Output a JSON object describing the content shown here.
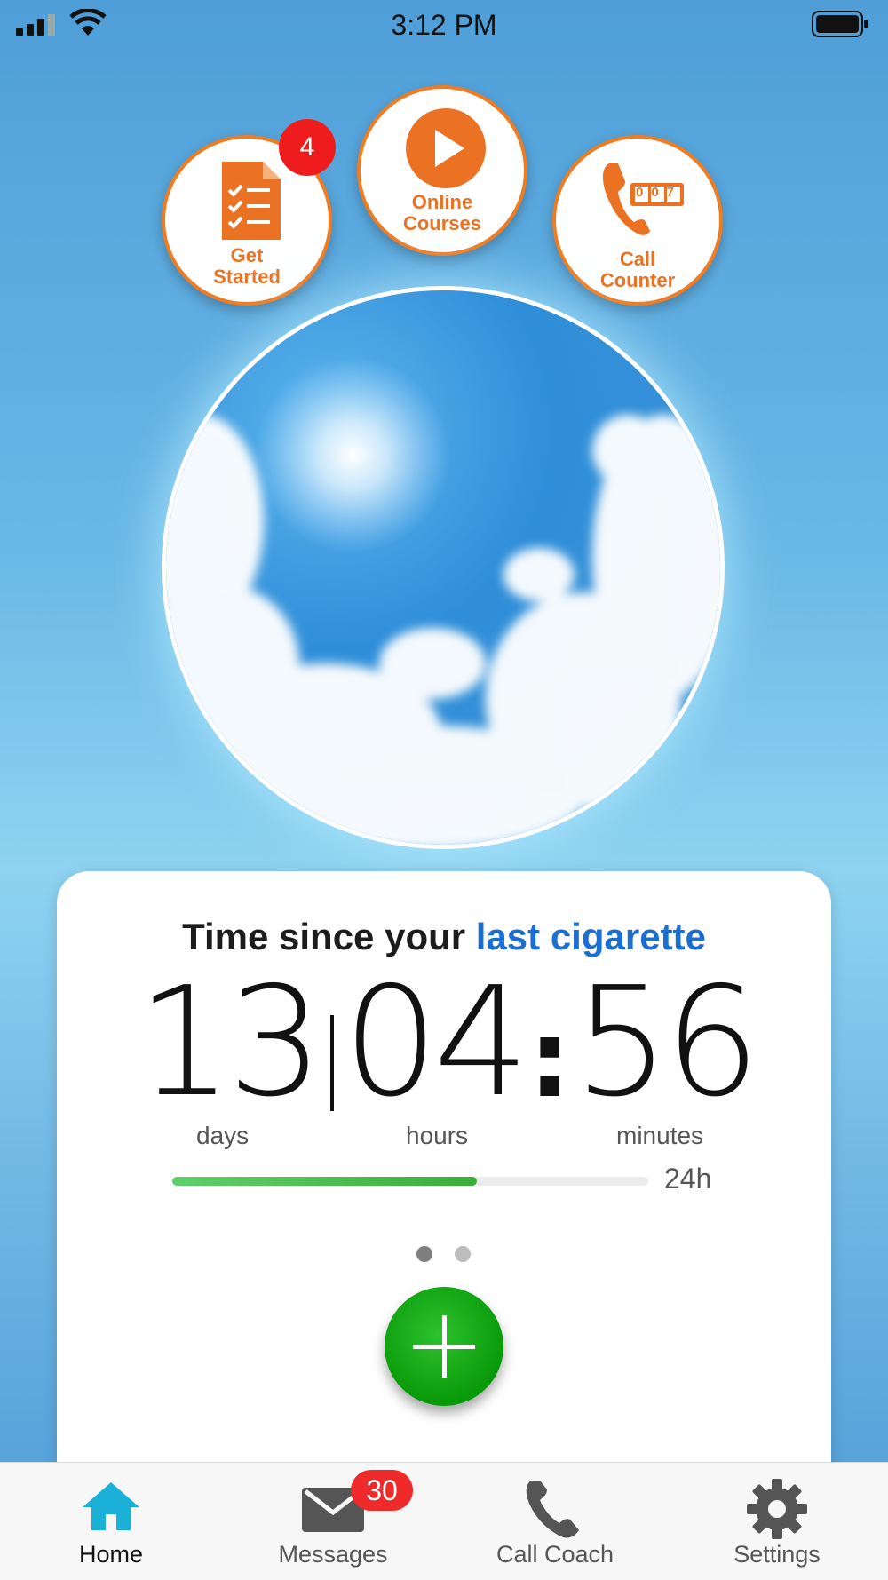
{
  "status_bar": {
    "time": "3:12 PM"
  },
  "shortcuts": [
    {
      "label": "Get\nStarted",
      "badge": "4",
      "icon": "checklist-icon"
    },
    {
      "label": "Online\nCourses",
      "icon": "play-icon"
    },
    {
      "label": "Call\nCounter",
      "icon": "phone-counter-icon",
      "counter_digits": "007"
    }
  ],
  "timer": {
    "title_prefix": "Time since your ",
    "title_accent": "last cigarette",
    "days": "13",
    "hours": "04",
    "colon": ":",
    "minutes": "56",
    "days_label": "days",
    "hours_label": "hours",
    "minutes_label": "minutes",
    "progress_fraction": 0.64,
    "progress_label": "24h"
  },
  "pager": {
    "count": 2,
    "active_index": 0
  },
  "tabs": [
    {
      "label": "Home",
      "icon": "home-icon",
      "active": true
    },
    {
      "label": "Messages",
      "icon": "envelope-icon",
      "badge": "30"
    },
    {
      "label": "Call Coach",
      "icon": "phone-icon"
    },
    {
      "label": "Settings",
      "icon": "gear-icon"
    }
  ],
  "colors": {
    "accent_orange": "#f07c22",
    "accent_blue": "#1b6fd1",
    "tab_active": "#1ab0d8",
    "progress_green": "#3aae3a"
  }
}
